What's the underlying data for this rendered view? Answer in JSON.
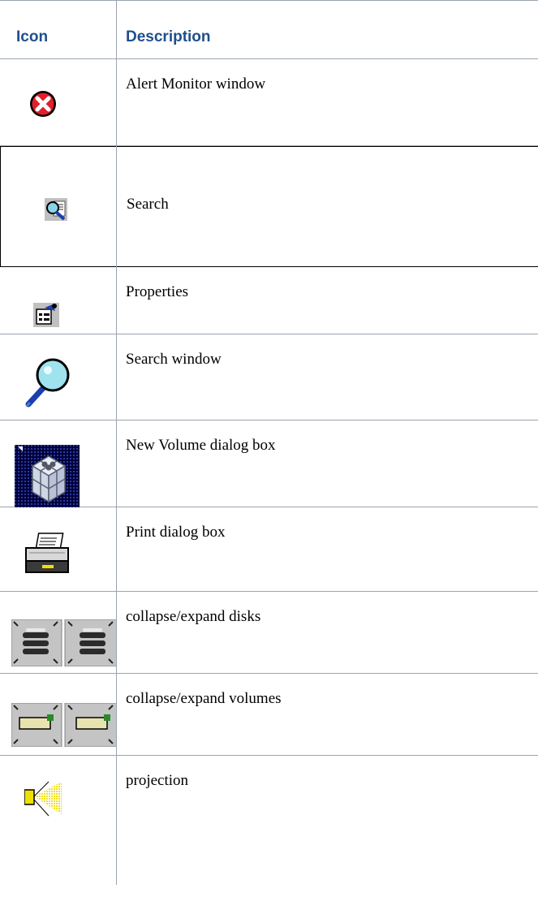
{
  "table": {
    "headers": {
      "icon": "Icon",
      "description": "Description"
    },
    "rows": [
      {
        "icon": "alert-monitor-icon",
        "description": "Alert Monitor window"
      },
      {
        "icon": "search-icon",
        "description": "Search"
      },
      {
        "icon": "properties-icon",
        "description": "Properties"
      },
      {
        "icon": "magnifier-icon",
        "description": "Search window"
      },
      {
        "icon": "new-volume-icon",
        "description": "New Volume dialog box"
      },
      {
        "icon": "printer-icon",
        "description": "Print dialog box"
      },
      {
        "icon": "collapse-expand-disks-icon",
        "description": "collapse/expand disks"
      },
      {
        "icon": "collapse-expand-volumes-icon",
        "description": "collapse/expand volumes"
      },
      {
        "icon": "projection-icon",
        "description": "projection"
      }
    ]
  },
  "colors": {
    "header_text": "#1f4f8b",
    "rule": "#9aa4b0"
  }
}
